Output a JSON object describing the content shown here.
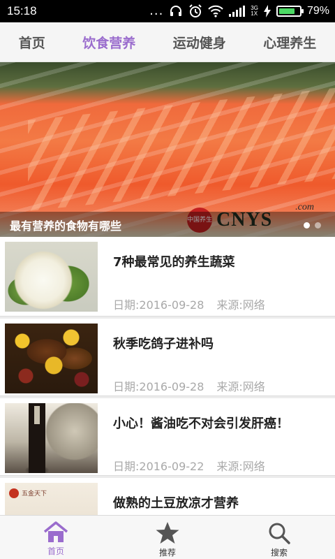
{
  "status_bar": {
    "time": "15:18",
    "dots": "...",
    "network_label_top": "3G",
    "network_label_bottom": "1X",
    "battery_percent": "79%",
    "battery_level": 0.79
  },
  "tabs": [
    {
      "label": "首页",
      "active": false
    },
    {
      "label": "饮食营养",
      "active": true
    },
    {
      "label": "运动健身",
      "active": false
    },
    {
      "label": "心理养生",
      "active": false
    }
  ],
  "banner": {
    "caption": "最有营养的食物有哪些",
    "logo_text": "CNYS",
    "logo_domain": ".com",
    "seal_text": "中国养生",
    "slide_count": 2,
    "active_slide": 0
  },
  "articles": [
    {
      "title": "7种最常见的养生蔬菜",
      "date": "日期:2016-09-28",
      "source": "来源:网络",
      "image": "cauliflower"
    },
    {
      "title": "秋季吃鸽子进补吗",
      "date": "日期:2016-09-28",
      "source": "来源:网络",
      "image": "braised-pigeon"
    },
    {
      "title": "小心！酱油吃不对会引发肝癌！",
      "date": "日期:2016-09-22",
      "source": "来源:网络",
      "image": "soy-sauce-bottle"
    },
    {
      "title": "做熟的土豆放凉才营养",
      "date": "",
      "source": "",
      "image": "potatoes",
      "image_text": "五金天下"
    }
  ],
  "bottom_nav": [
    {
      "label": "首页",
      "icon": "home-icon",
      "active": true
    },
    {
      "label": "推荐",
      "icon": "star-icon",
      "active": false
    },
    {
      "label": "搜索",
      "icon": "search-icon",
      "active": false
    }
  ],
  "colors": {
    "accent": "#9a6ccd",
    "tab_inactive": "#555555",
    "meta_text": "#a9a9a9",
    "nav_icon_inactive": "#555555"
  }
}
